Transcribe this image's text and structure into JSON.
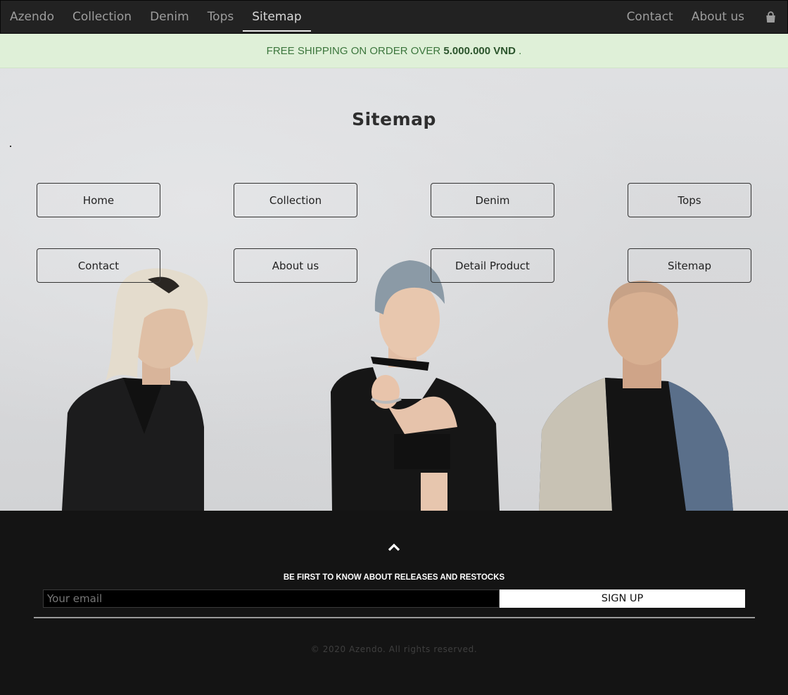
{
  "nav": {
    "brand": "Azendo",
    "left_items": [
      "Collection",
      "Denim",
      "Tops",
      "Sitemap"
    ],
    "right_items": [
      "Contact",
      "About us"
    ],
    "active": "Sitemap",
    "cart_icon": "shopping-bag-icon"
  },
  "banner": {
    "text_prefix": "FREE SHIPPING ON ORDER OVER ",
    "amount": "5.000.000 VND",
    "text_suffix": " ."
  },
  "page": {
    "title": "Sitemap",
    "links": [
      "Home",
      "Collection",
      "Denim",
      "Tops",
      "Contact",
      "About us",
      "Detail Product",
      "Sitemap"
    ]
  },
  "footer": {
    "back_to_top_icon": "chevron-up-icon",
    "heading": "BE FIRST TO KNOW ABOUT RELEASES AND RESTOCKS",
    "email_placeholder": "Your email",
    "signup_label": "SIGN UP",
    "copyright": "© 2020 Azendo. All rights reserved."
  },
  "colors": {
    "navbar_bg": "#222222",
    "banner_bg": "#dff0d8",
    "banner_text": "#3c763d",
    "footer_bg": "#141414"
  }
}
